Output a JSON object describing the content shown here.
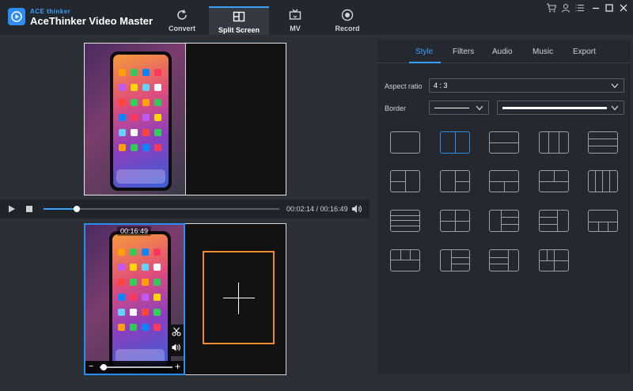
{
  "app": {
    "brand_small": "ACE thinker",
    "title": "AceThinker Video Master"
  },
  "tabs": [
    {
      "label": "Convert",
      "icon": "refresh-icon"
    },
    {
      "label": "Split Screen",
      "icon": "split-screen-icon"
    },
    {
      "label": "MV",
      "icon": "tv-icon"
    },
    {
      "label": "Record",
      "icon": "record-icon"
    }
  ],
  "window_controls": [
    "cart-icon",
    "user-icon",
    "menu-icon",
    "minimize-icon",
    "maximize-icon",
    "close-icon"
  ],
  "player": {
    "time": "00:02:14 / 00:16:49",
    "progress": 0.14
  },
  "edit": {
    "duration": "00:16:49",
    "zoom": 0.05
  },
  "right_tabs": [
    "Style",
    "Filters",
    "Audio",
    "Music",
    "Export"
  ],
  "style": {
    "aspect_label": "Aspect ratio",
    "aspect_value": "4 : 3",
    "border_label": "Border"
  },
  "colors": {
    "accent": "#2d8cf0",
    "add_box": "#f08a2a",
    "background": "#2b2f36",
    "panel": "#25292f"
  }
}
